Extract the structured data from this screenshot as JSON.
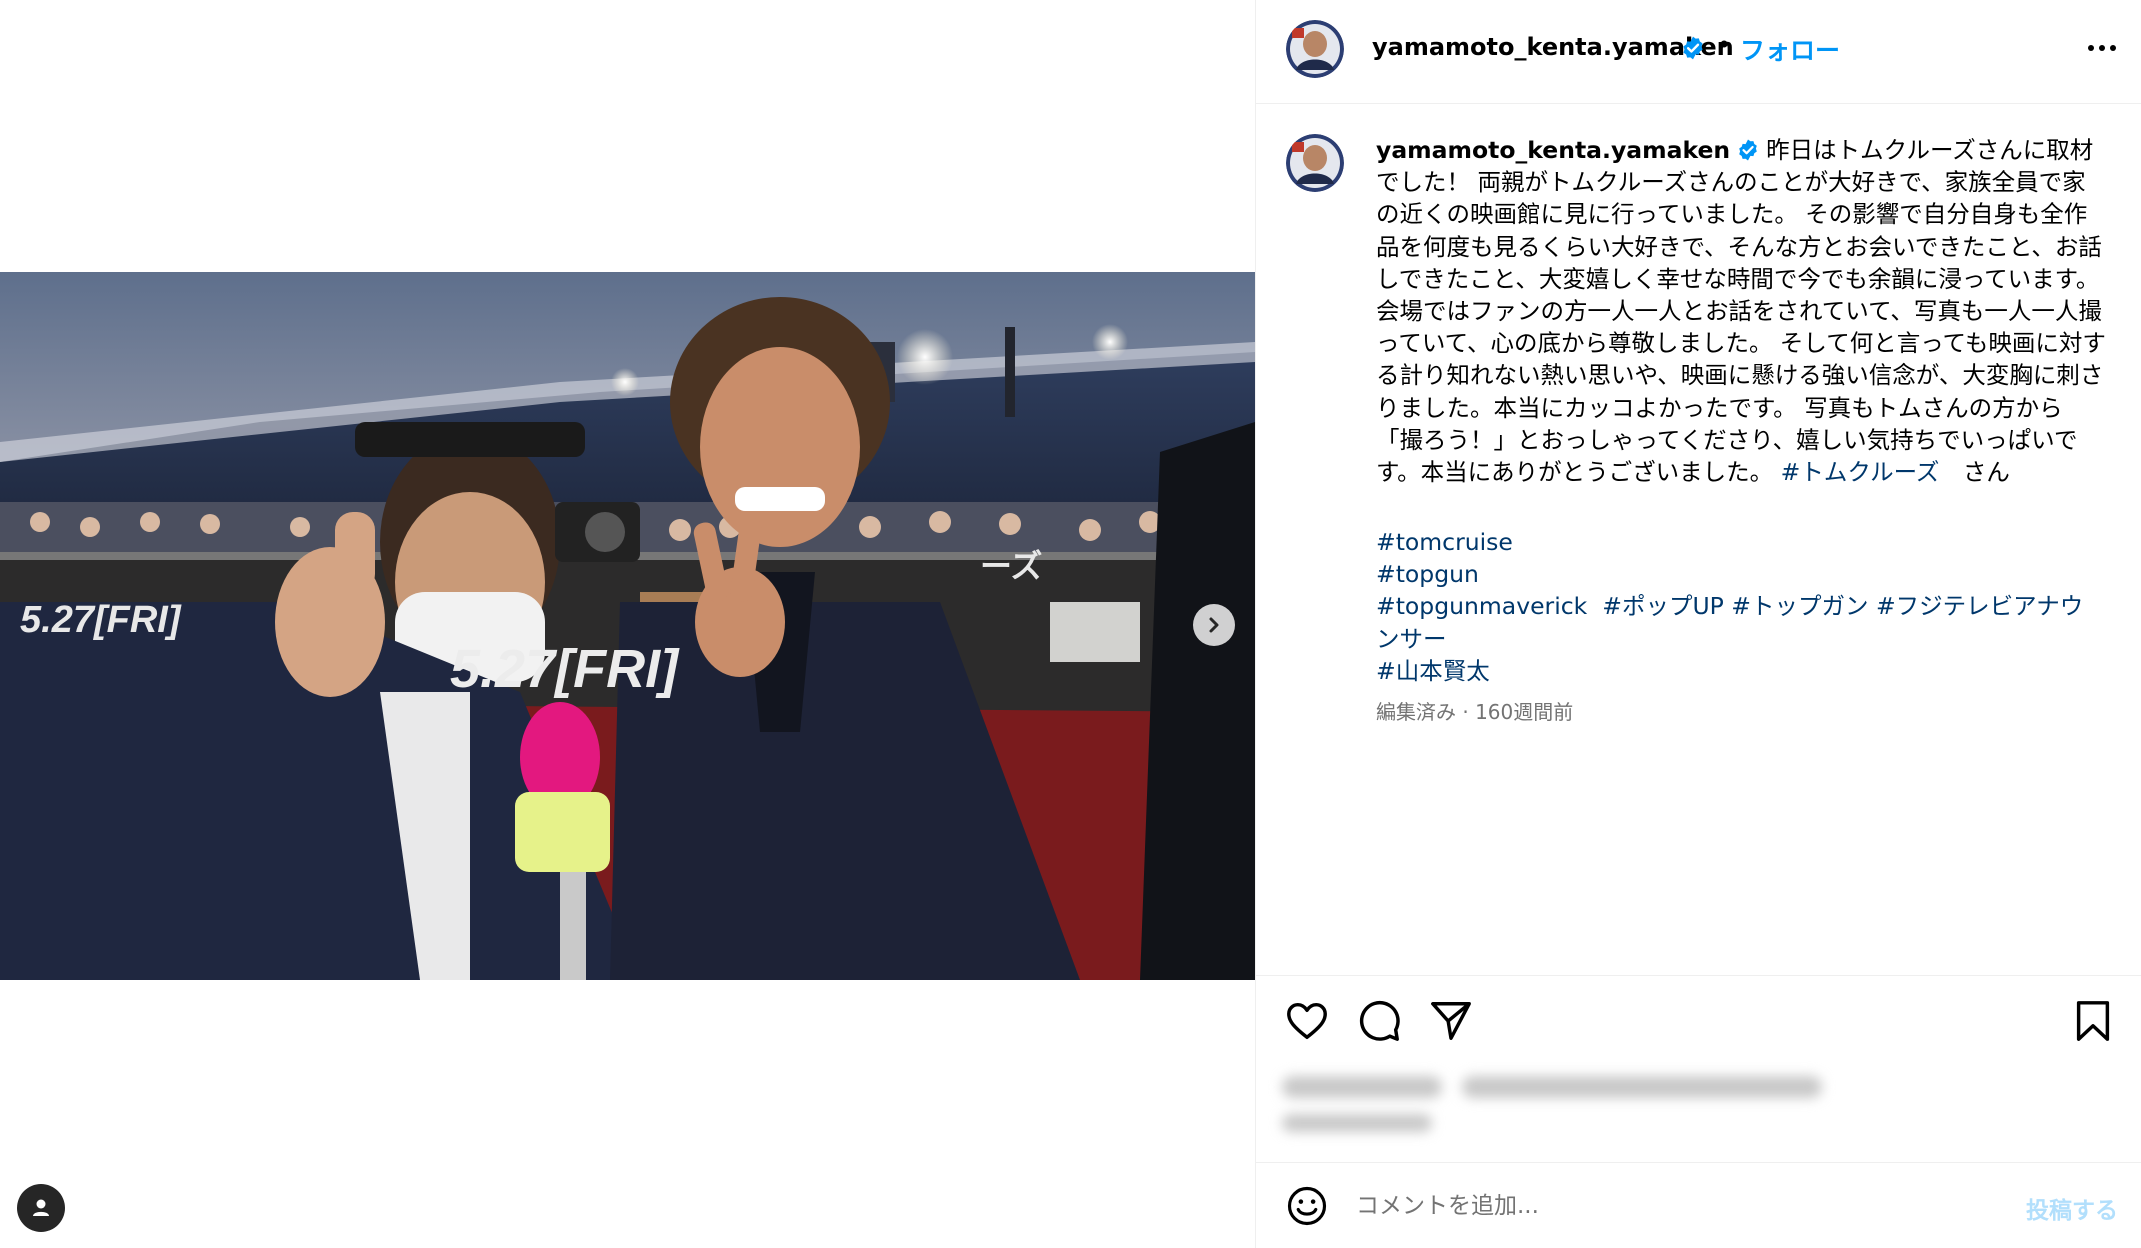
{
  "post": {
    "username": "yamamoto_kenta.yamaken",
    "separator": "•",
    "follow_label": "フォロー",
    "more_icon": "more-horizontal-icon",
    "verified_icon": "verified-badge-icon",
    "verified_color": "#0095f6"
  },
  "caption": {
    "username": "yamamoto_kenta.yamaken",
    "text": "昨日はトムクルーズさんに取材でした！ 両親がトムクルーズさんのことが大好きで、家族全員で家の近くの映画館に見に行っていました。 その影響で自分自身も全作品を何度も見るくらい大好きで、そんな方とお会いできたこと、お話しできたこと、大変嬉しく幸せな時間で今でも余韻に浸っています。 会場ではファンの方一人一人とお話をされていて、写真も一人一人撮っていて、心の底から尊敬しました。 そして何と言っても映画に対する計り知れない熱い思いや、映画に懸ける強い信念が、大変胸に刺さりました。本当にカッコよかったです。 写真もトムさんの方から「撮ろう！」とおっしゃってくださり、嬉しい気持ちでいっぱいです。本当にありがとうございました。 ",
    "mention": "#トムクルーズ",
    "mention_suffix": "　さん",
    "tags": [
      "#tomcruise",
      "#topgun",
      "#topgunmaverick",
      "#ポップUP",
      "#トップガン",
      "#フジテレビアナウンサー",
      "#山本賢太"
    ],
    "edited": "編集済み",
    "dot": "·",
    "time": "160週間前",
    "link_color": "#00376b"
  },
  "media": {
    "next_icon": "chevron-right-icon",
    "tag_icon": "user-tag-icon",
    "banner_date_left": "5.27[FRI]",
    "banner_date_center": "5.27[FRI]",
    "banner_text_right": "ーズ"
  },
  "actions": {
    "like_icon": "heart-icon",
    "comment_icon": "comment-icon",
    "share_icon": "send-icon",
    "save_icon": "bookmark-icon"
  },
  "comment_box": {
    "emoji_icon": "emoji-icon",
    "placeholder": "コメントを追加...",
    "post_label": "投稿する",
    "post_color": "#b2dffc"
  }
}
